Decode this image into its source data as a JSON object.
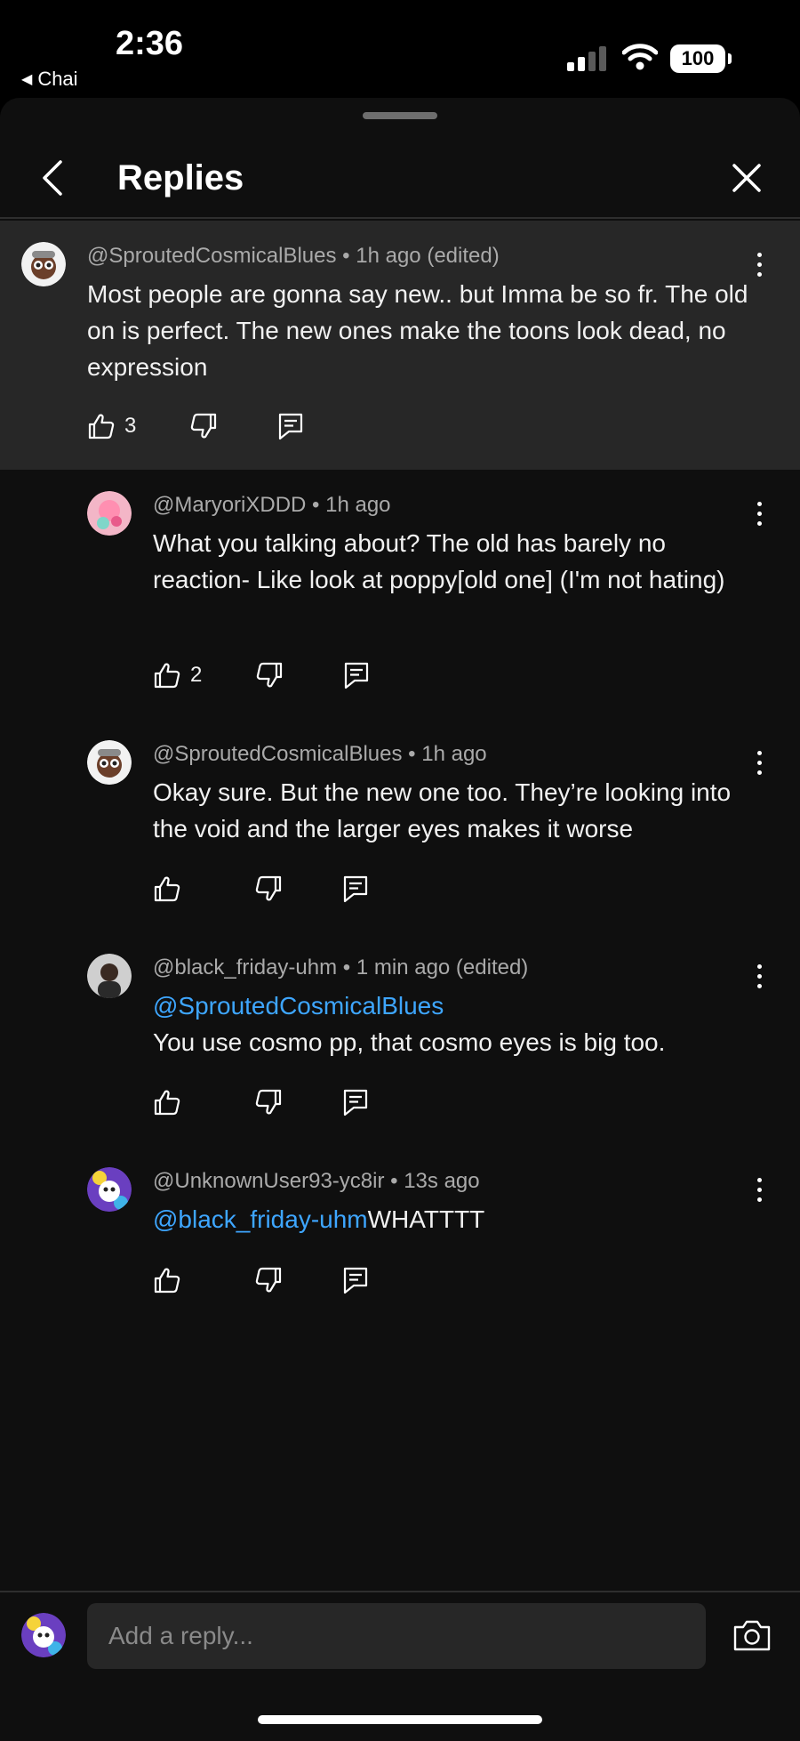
{
  "status_bar": {
    "time": "2:36",
    "back_app": "Chai",
    "battery": "100"
  },
  "header": {
    "title": "Replies"
  },
  "main_comment": {
    "author": "@SproutedCosmicalBlues",
    "time": "1h ago (edited)",
    "text": "Most people are gonna say new.. but Imma be so fr. The old on is perfect. The new ones make the toons look dead, no expression",
    "likes": "3"
  },
  "replies": [
    {
      "author": "@MaryoriXDDD",
      "time": "1h ago",
      "text": "What you talking about? The old has barely no reaction- Like look at poppy[old one] (I'm not hating)",
      "likes": "2"
    },
    {
      "author": "@SproutedCosmicalBlues",
      "time": "1h ago",
      "text": "Okay sure. But the new one too. They’re looking into the void and the larger eyes makes it worse",
      "likes": ""
    },
    {
      "author": "@black_friday-uhm",
      "time": "1 min ago (edited)",
      "mention": "@SproutedCosmicalBlues",
      "text": "You use cosmo pp, that cosmo eyes is big too.",
      "likes": ""
    },
    {
      "author": "@UnknownUser93-yc8ir",
      "time": "13s ago",
      "mention": "@black_friday-uhm",
      "text": "WHATTTT",
      "likes": ""
    }
  ],
  "composer": {
    "placeholder": "Add a reply..."
  },
  "colors": {
    "background": "#0f0f0f",
    "highlight": "#272727",
    "mention": "#3ea6ff",
    "meta": "#aaaaaa"
  },
  "icons": [
    "chevron-left-icon",
    "close-icon",
    "kebab-icon",
    "thumb-up-icon",
    "thumb-down-icon",
    "reply-icon",
    "camera-icon",
    "signal-icon",
    "wifi-icon"
  ]
}
